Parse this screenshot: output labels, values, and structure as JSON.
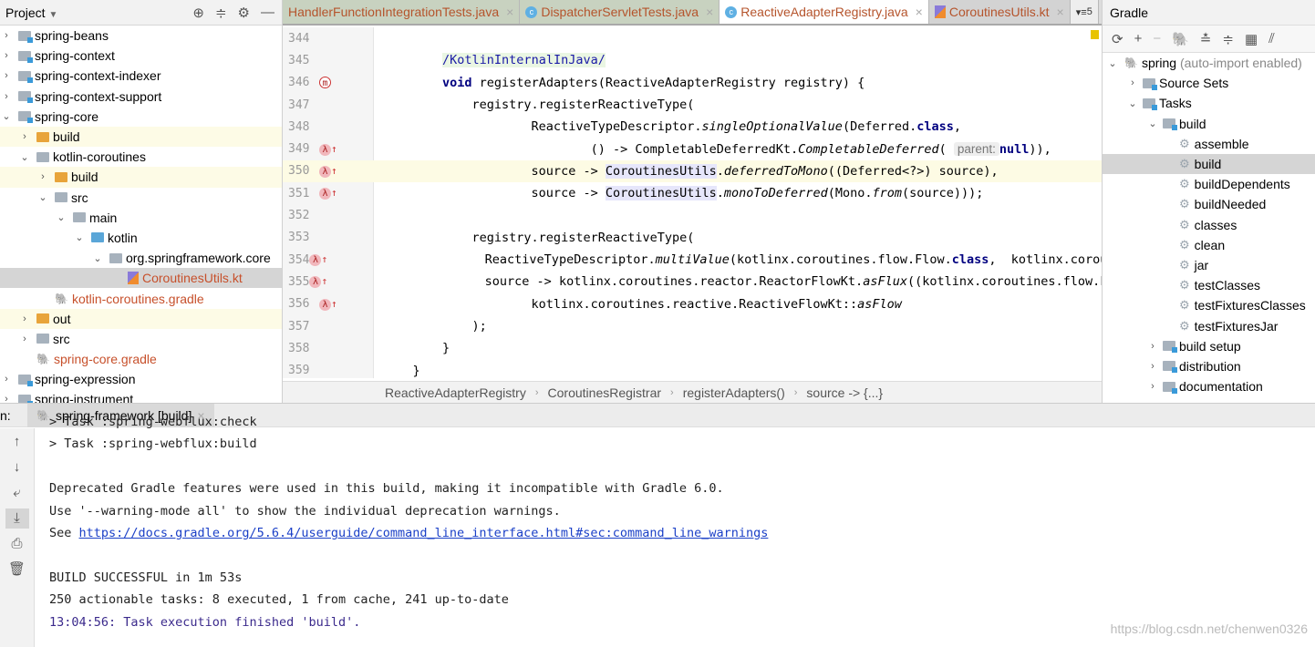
{
  "project": {
    "title": "Project",
    "tools": [
      "target-icon",
      "collapse-icon",
      "gear-icon",
      "minimize-icon"
    ],
    "tree": [
      {
        "label": "spring-beans",
        "depth": 0,
        "arrow": "›",
        "icon": "module",
        "state": ""
      },
      {
        "label": "spring-context",
        "depth": 0,
        "arrow": "›",
        "icon": "module",
        "state": ""
      },
      {
        "label": "spring-context-indexer",
        "depth": 0,
        "arrow": "›",
        "icon": "module",
        "state": ""
      },
      {
        "label": "spring-context-support",
        "depth": 0,
        "arrow": "›",
        "icon": "module",
        "state": ""
      },
      {
        "label": "spring-core",
        "depth": 0,
        "arrow": "⌄",
        "icon": "module",
        "state": ""
      },
      {
        "label": "build",
        "depth": 1,
        "arrow": "›",
        "icon": "orange",
        "state": "hl"
      },
      {
        "label": "kotlin-coroutines",
        "depth": 1,
        "arrow": "⌄",
        "icon": "folder",
        "state": ""
      },
      {
        "label": "build",
        "depth": 2,
        "arrow": "›",
        "icon": "orange",
        "state": "hl"
      },
      {
        "label": "src",
        "depth": 2,
        "arrow": "⌄",
        "icon": "folder",
        "state": ""
      },
      {
        "label": "main",
        "depth": 3,
        "arrow": "⌄",
        "icon": "folder",
        "state": ""
      },
      {
        "label": "kotlin",
        "depth": 4,
        "arrow": "⌄",
        "icon": "blue",
        "state": ""
      },
      {
        "label": "org.springframework.core",
        "depth": 5,
        "arrow": "⌄",
        "icon": "folder",
        "state": ""
      },
      {
        "label": "CoroutinesUtils.kt",
        "depth": 6,
        "arrow": "",
        "icon": "kotlin",
        "state": "sel",
        "orange": true
      },
      {
        "label": "kotlin-coroutines.gradle",
        "depth": 2,
        "arrow": "",
        "icon": "gradle",
        "state": "",
        "orange": true
      },
      {
        "label": "out",
        "depth": 1,
        "arrow": "›",
        "icon": "orange",
        "state": "hl"
      },
      {
        "label": "src",
        "depth": 1,
        "arrow": "›",
        "icon": "folder",
        "state": ""
      },
      {
        "label": "spring-core.gradle",
        "depth": 1,
        "arrow": "",
        "icon": "gradle",
        "state": "",
        "orange": true
      },
      {
        "label": "spring-expression",
        "depth": 0,
        "arrow": "›",
        "icon": "module",
        "state": ""
      },
      {
        "label": "spring-instrument",
        "depth": 0,
        "arrow": "›",
        "icon": "module",
        "state": ""
      }
    ]
  },
  "editor": {
    "tabs": [
      {
        "label": "HandlerFunctionIntegrationTests.java",
        "active": false
      },
      {
        "label": "DispatcherServletTests.java",
        "active": false,
        "icon": "C"
      },
      {
        "label": "ReactiveAdapterRegistry.java",
        "active": true,
        "icon": "C"
      },
      {
        "label": "CoroutinesUtils.kt",
        "active": false,
        "kotlin": true
      }
    ],
    "tab_overflow": "5",
    "lines": [
      {
        "n": "344",
        "m": "",
        "s": []
      },
      {
        "n": "345",
        "m": "",
        "s": [
          [
            "        ",
            ""
          ],
          [
            "/KotlinInternalInJava/",
            "ann"
          ]
        ]
      },
      {
        "n": "346",
        "m": "m",
        "s": [
          [
            "        ",
            ""
          ],
          [
            "void ",
            "k"
          ],
          [
            "registerAdapters(ReactiveAdapterRegistry registry) {",
            ""
          ]
        ]
      },
      {
        "n": "347",
        "m": "",
        "s": [
          [
            "            registry.registerReactiveType(",
            ""
          ]
        ]
      },
      {
        "n": "348",
        "m": "",
        "s": [
          [
            "                    ReactiveTypeDescriptor.",
            ""
          ],
          [
            "singleOptionalValue",
            "i"
          ],
          [
            "(Deferred.",
            ""
          ],
          [
            "class",
            "k"
          ],
          [
            ",",
            ""
          ]
        ]
      },
      {
        "n": "349",
        "m": "l",
        "s": [
          [
            "                            () -> CompletableDeferredKt.",
            ""
          ],
          [
            "CompletableDeferred",
            "i"
          ],
          [
            "( ",
            ""
          ],
          [
            "parent:",
            "hint"
          ],
          [
            "null",
            "k"
          ],
          [
            ")),",
            ""
          ]
        ]
      },
      {
        "n": "350",
        "m": "l",
        "cur": true,
        "s": [
          [
            "                    source -> ",
            ""
          ],
          [
            "CoroutinesUtils",
            "usage"
          ],
          [
            ".",
            ""
          ],
          [
            "deferredToMono",
            "i"
          ],
          [
            "((Deferred<?>) source),",
            ""
          ]
        ]
      },
      {
        "n": "351",
        "m": "l",
        "s": [
          [
            "                    source -> ",
            ""
          ],
          [
            "CoroutinesUtils",
            "usage"
          ],
          [
            ".",
            ""
          ],
          [
            "monoToDeferred",
            "i"
          ],
          [
            "(Mono.",
            ""
          ],
          [
            "from",
            "i"
          ],
          [
            "(source)));",
            ""
          ]
        ]
      },
      {
        "n": "352",
        "m": "",
        "s": []
      },
      {
        "n": "353",
        "m": "",
        "s": [
          [
            "            registry.registerReactiveType(",
            ""
          ]
        ]
      },
      {
        "n": "354",
        "m": "l",
        "s": [
          [
            "                    ReactiveTypeDescriptor.",
            ""
          ],
          [
            "multiValue",
            "i"
          ],
          [
            "(kotlinx.coroutines.flow.Flow.",
            ""
          ],
          [
            "class",
            "k"
          ],
          [
            ",  kotlinx.coroutines.flow.FlowKt.emptyFlow()),",
            ""
          ]
        ]
      },
      {
        "n": "355",
        "m": "l",
        "s": [
          [
            "                    source -> kotlinx.coroutines.reactor.ReactorFlowKt.",
            ""
          ],
          [
            "asFlux",
            "i"
          ],
          [
            "((kotlinx.coroutines.flow.Flow<?>) source),",
            ""
          ]
        ]
      },
      {
        "n": "356",
        "m": "l",
        "s": [
          [
            "                    kotlinx.coroutines.reactive.ReactiveFlowKt::",
            ""
          ],
          [
            "asFlow",
            "i"
          ]
        ]
      },
      {
        "n": "357",
        "m": "",
        "s": [
          [
            "            );",
            ""
          ]
        ]
      },
      {
        "n": "358",
        "m": "",
        "s": [
          [
            "        }",
            ""
          ]
        ]
      },
      {
        "n": "359",
        "m": "",
        "s": [
          [
            "    }",
            ""
          ]
        ]
      }
    ],
    "breadcrumb": [
      "ReactiveAdapterRegistry",
      "CoroutinesRegistrar",
      "registerAdapters()",
      "source -> {...}"
    ]
  },
  "gradle": {
    "title": "Gradle",
    "tools": [
      "refresh-icon",
      "add-icon",
      "remove-icon",
      "elephant-icon",
      "expand-all-icon",
      "collapse-all-icon",
      "group-modules-icon",
      "toggle-offline-icon"
    ],
    "root": {
      "label": "spring",
      "note": "(auto-import enabled)"
    },
    "tree": [
      {
        "label": "Source Sets",
        "depth": 1,
        "arrow": "›",
        "type": "folder"
      },
      {
        "label": "Tasks",
        "depth": 1,
        "arrow": "⌄",
        "type": "folder"
      },
      {
        "label": "build",
        "depth": 2,
        "arrow": "⌄",
        "type": "folder"
      },
      {
        "label": "assemble",
        "depth": 3,
        "type": "task"
      },
      {
        "label": "build",
        "depth": 3,
        "type": "task",
        "sel": true
      },
      {
        "label": "buildDependents",
        "depth": 3,
        "type": "task"
      },
      {
        "label": "buildNeeded",
        "depth": 3,
        "type": "task"
      },
      {
        "label": "classes",
        "depth": 3,
        "type": "task"
      },
      {
        "label": "clean",
        "depth": 3,
        "type": "task"
      },
      {
        "label": "jar",
        "depth": 3,
        "type": "task"
      },
      {
        "label": "testClasses",
        "depth": 3,
        "type": "task"
      },
      {
        "label": "testFixturesClasses",
        "depth": 3,
        "type": "task"
      },
      {
        "label": "testFixturesJar",
        "depth": 3,
        "type": "task"
      },
      {
        "label": "build setup",
        "depth": 2,
        "arrow": "›",
        "type": "folder"
      },
      {
        "label": "distribution",
        "depth": 2,
        "arrow": "›",
        "type": "folder"
      },
      {
        "label": "documentation",
        "depth": 2,
        "arrow": "›",
        "type": "folder"
      }
    ]
  },
  "run": {
    "label": "n:",
    "tab": "spring-framework [build]",
    "console": [
      {
        "t": "> Task :spring-webflux:check",
        "y": 0
      },
      {
        "t": "> Task :spring-webflux:build",
        "y": 1
      },
      {
        "t": "Deprecated Gradle features were used in this build, making it incompatible with Gradle 6.0.",
        "y": 3
      },
      {
        "t": "Use '--warning-mode all' to show the individual deprecation warnings.",
        "y": 4
      },
      {
        "t": "See ",
        "link": "https://docs.gradle.org/5.6.4/userguide/command_line_interface.html#sec:command_line_warnings",
        "y": 5
      },
      {
        "t": "BUILD SUCCESSFUL in 1m 53s",
        "y": 7
      },
      {
        "t": "250 actionable tasks: 8 executed, 1 from cache, 241 up-to-date",
        "y": 8
      },
      {
        "t": "13:04:56: Task execution finished 'build'.",
        "y": 9,
        "purple": true
      }
    ]
  },
  "watermark": "https://blog.csdn.net/chenwen0326"
}
